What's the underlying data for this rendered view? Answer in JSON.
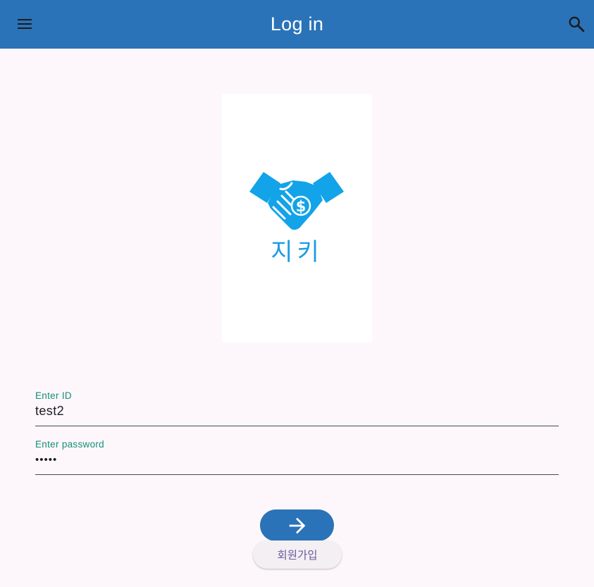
{
  "colors": {
    "primary": "#2a73b8",
    "brand": "#1d9be4",
    "accent": "#12907a",
    "signup": "#675f9d"
  },
  "appbar": {
    "title": "Log in",
    "menu_icon": "hamburger-menu-icon",
    "search_icon": "search-icon"
  },
  "logo": {
    "icon": "handshake-dollar-icon",
    "text": "지키"
  },
  "form": {
    "id_field": {
      "label": "Enter ID",
      "value": "test2"
    },
    "password_field": {
      "label": "Enter password",
      "value": "•••••"
    }
  },
  "actions": {
    "submit_icon": "arrow-right-icon",
    "signup_label": "회원가입"
  }
}
